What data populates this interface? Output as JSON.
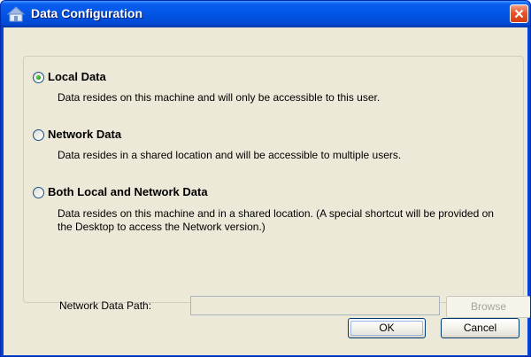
{
  "window": {
    "title": "Data Configuration",
    "title_icon": "house-icon",
    "close_icon": "close-icon"
  },
  "options": [
    {
      "label": "Local Data",
      "description": "Data resides on this machine and will only be accessible to this user.",
      "selected": true
    },
    {
      "label": "Network Data",
      "description": "Data resides in a shared location and will be accessible to multiple users.",
      "selected": false
    },
    {
      "label": "Both Local and Network Data",
      "description": "Data resides on this machine and in a shared location.  (A special shortcut will be provided on the Desktop to access the Network version.)",
      "selected": false
    }
  ],
  "network_path": {
    "label": "Network Data Path:",
    "value": "",
    "browse_label": "Browse"
  },
  "buttons": {
    "ok_label": "OK",
    "cancel_label": "Cancel"
  },
  "colors": {
    "titlebar": "#0254e4",
    "client_bg": "#ece9d8",
    "close_button": "#e8542a",
    "radio_selected": "#21a121"
  }
}
